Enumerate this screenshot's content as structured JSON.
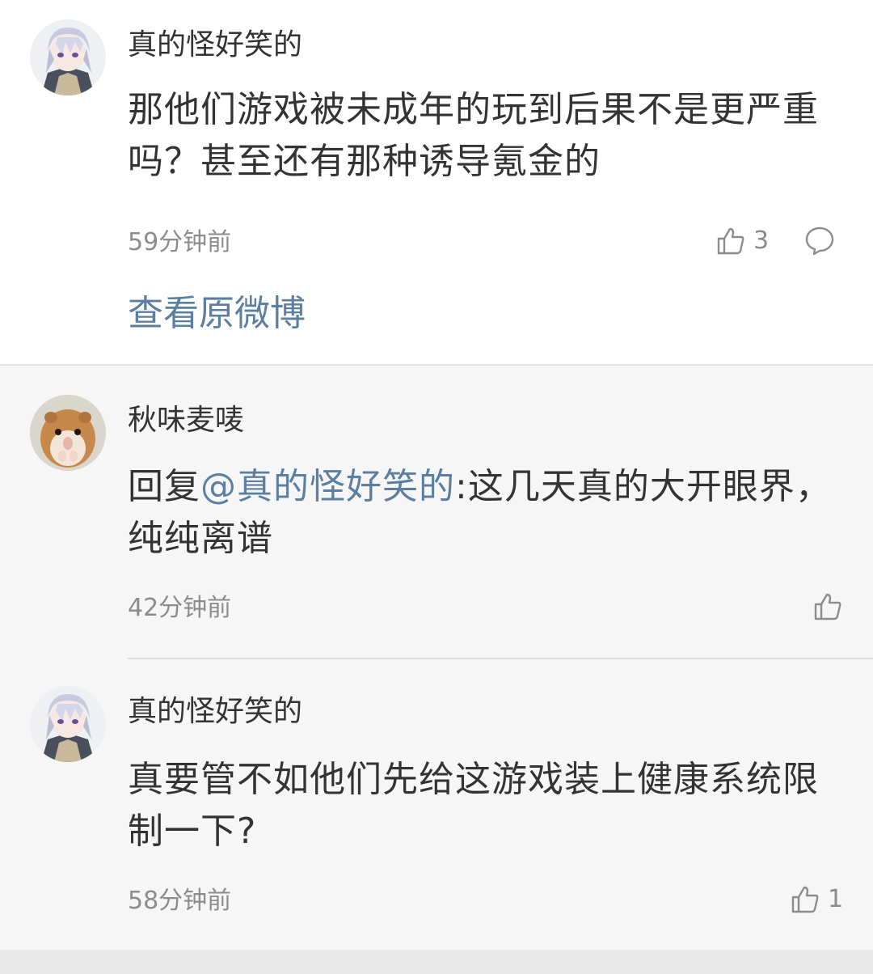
{
  "main_comment": {
    "username": "真的怪好笑的",
    "text": "那他们游戏被未成年的玩到后果不是更严重吗？甚至还有那种诱导氪金的",
    "time": "59分钟前",
    "like_count": "3",
    "view_original": "查看原微博"
  },
  "replies": [
    {
      "username": "秋味麦唛",
      "prefix": "回复",
      "mention": "@真的怪好笑的",
      "text": ":这几天真的大开眼界，纯纯离谱",
      "time": "42分钟前",
      "like_count": ""
    },
    {
      "username": "真的怪好笑的",
      "text": "真要管不如他们先给这游戏装上健康系统限制一下?",
      "time": "58分钟前",
      "like_count": "1"
    }
  ],
  "icons": {
    "like": "thumbs-up-icon",
    "comment": "comment-bubble-icon"
  },
  "colors": {
    "link": "#5b7fa0",
    "text": "#333333",
    "meta": "#8c8c8c"
  }
}
